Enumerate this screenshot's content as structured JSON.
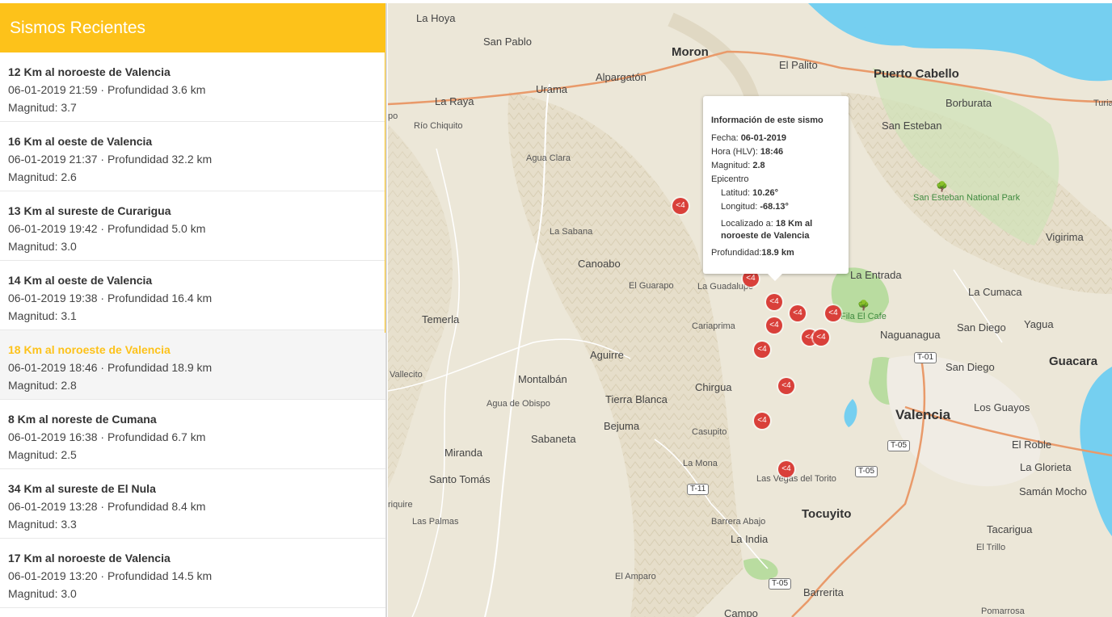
{
  "sidebar": {
    "title": "Sismos Recientes",
    "items": [
      {
        "title": "12 Km al noroeste de Valencia",
        "meta": "06-01-2019 21:59 · Profundidad 3.6 km",
        "mag": "Magnitud: 3.7"
      },
      {
        "title": "16 Km al oeste de Valencia",
        "meta": "06-01-2019 21:37 · Profundidad 32.2 km",
        "mag": "Magnitud: 2.6"
      },
      {
        "title": "13 Km al sureste de Curarigua",
        "meta": "06-01-2019 19:42 · Profundidad 5.0 km",
        "mag": "Magnitud: 3.0"
      },
      {
        "title": "14 Km al oeste de Valencia",
        "meta": "06-01-2019 19:38 · Profundidad 16.4 km",
        "mag": "Magnitud: 3.1"
      },
      {
        "title": "18 Km al noroeste de Valencia",
        "meta": "06-01-2019 18:46 · Profundidad 18.9 km",
        "mag": "Magnitud: 2.8"
      },
      {
        "title": "8 Km al noreste de Cumana",
        "meta": "06-01-2019 16:38 · Profundidad 6.7 km",
        "mag": "Magnitud: 2.5"
      },
      {
        "title": "34 Km al sureste de El Nula",
        "meta": "06-01-2019 13:28 · Profundidad 8.4 km",
        "mag": "Magnitud: 3.3"
      },
      {
        "title": "17 Km al noroeste de Valencia",
        "meta": "06-01-2019 13:20 · Profundidad 14.5 km",
        "mag": "Magnitud: 3.0"
      }
    ]
  },
  "map": {
    "places": {
      "la_hoya": "La Hoya",
      "san_pablo": "San Pablo",
      "moron": "Moron",
      "el_palito": "El Palito",
      "puerto_cabello": "Puerto Cabello",
      "alpargaton": "Alpargatón",
      "urama": "Urama",
      "la_raya": "La Raya",
      "borburata": "Borburata",
      "turia": "Turia",
      "po": "po",
      "rio_chiquito": "Río Chiquito",
      "san_esteban": "San Esteban",
      "agua_clara": "Agua Clara",
      "san_esteban_np": "San Esteban National Park",
      "la_sabana": "La Sabana",
      "vigirima": "Vigirima",
      "canoabo": "Canoabo",
      "el_guarapo": "El Guarapo",
      "la_guadalupe": "La Guadalupe",
      "la_entrada": "La Entrada",
      "la_cumaca": "La Cumaca",
      "temerla": "Temerla",
      "fila_el_cafe": "Fila El Cafe",
      "naguanagua": "Naguanagua",
      "san_diego_1": "San Diego",
      "yagua": "Yagua",
      "cariaprima": "Cariaprima",
      "aguirre": "Aguirre",
      "san_diego_2": "San Diego",
      "guacara": "Guacara",
      "vallecito": "Vallecito",
      "montalban": "Montalbán",
      "chirgua": "Chirgua",
      "agua_de_obispo": "Agua de Obispo",
      "tierra_blanca": "Tierra Blanca",
      "valencia": "Valencia",
      "los_guayos": "Los Guayos",
      "bejuma": "Bejuma",
      "casupito": "Casupito",
      "sabaneta": "Sabaneta",
      "el_roble": "El Roble",
      "miranda": "Miranda",
      "la_mona": "La Mona",
      "la_glorieta": "La Glorieta",
      "santo_tomas": "Santo Tomás",
      "las_vegas": "Las Vegas del Torito",
      "saman_mocho": "Samán Mocho",
      "riquire": "riquire",
      "las_palmas": "Las Palmas",
      "tocuyito": "Tocuyito",
      "barrera_abajo": "Barrera Abajo",
      "tacarigua": "Tacarigua",
      "la_india": "La India",
      "el_trillo": "El Trillo",
      "el_amparo": "El Amparo",
      "barrerita": "Barrerita",
      "campo": "Campo",
      "pomarrosa": "Pomarrosa"
    },
    "roads": {
      "t01": "T-01",
      "t05a": "T-05",
      "t05b": "T-05",
      "t05c": "T-05",
      "t05d": "T-05",
      "t11": "T-11",
      "t01top": "T-01"
    },
    "marker_label": "<4",
    "colors": {
      "marker": "#d9403a",
      "accent": "#fdc21a",
      "water": "#75cff0",
      "land": "#ece7d8",
      "park": "#b9dca0"
    }
  },
  "popup": {
    "title": "Información de este sismo",
    "fecha_label": "Fecha: ",
    "fecha": "06-01-2019",
    "hora_label": "Hora (HLV): ",
    "hora": "18:46",
    "mag_label": "Magnitud: ",
    "mag": "2.8",
    "epicentro": "Epicentro",
    "lat_label": "Latitud: ",
    "lat": "10.26°",
    "lon_label": "Longitud: ",
    "lon": "-68.13°",
    "loc_label": "Localizado a: ",
    "loc": "18 Km al noroeste de Valencia",
    "prof_label": "Profundidad:",
    "prof": "18.9 km"
  }
}
